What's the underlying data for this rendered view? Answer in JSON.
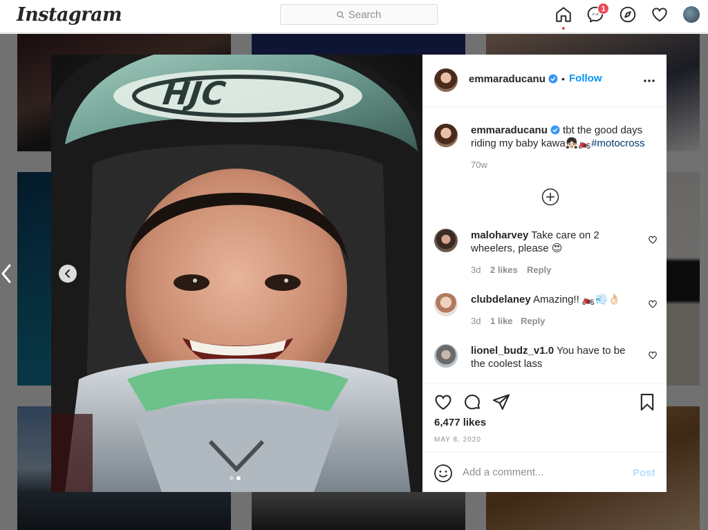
{
  "nav": {
    "logo": "Instagram",
    "search_placeholder": "Search",
    "messages_badge": "1"
  },
  "post": {
    "username": "emmaraducanu",
    "follow_label": "Follow",
    "separator": "•",
    "caption_text": "tbt the good days riding my baby kawa👧🏻🏍️",
    "caption_hashtag": "#motocross",
    "caption_age": "70w",
    "carousel_slide": 2,
    "carousel_total": 2,
    "likes": "6,477 likes",
    "date": "MAY 8, 2020"
  },
  "comments": [
    {
      "username": "maloharvey",
      "text": "Take care on 2 wheelers, please 😍",
      "age": "3d",
      "likes": "2 likes",
      "reply": "Reply"
    },
    {
      "username": "clubdelaney",
      "text": "Amazing!! 🏍️💨👌🏻",
      "age": "3d",
      "likes": "1 like",
      "reply": "Reply"
    },
    {
      "username": "lionel_budz_v1.0",
      "text": "You have to be the coolest lass"
    }
  ],
  "composer": {
    "placeholder": "Add a comment...",
    "post_label": "Post"
  },
  "colors": {
    "accent": "#0095f6",
    "verified": "#3897f0",
    "notification": "#ed4956"
  }
}
